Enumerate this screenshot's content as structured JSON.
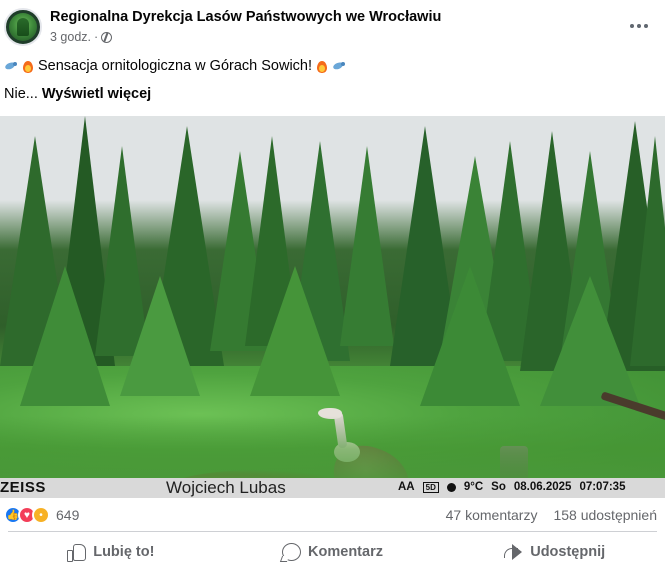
{
  "post": {
    "page_name": "Regionalna Dyrekcja Lasów Państwowych we Wrocławiu",
    "time": "3 godz.",
    "separator": "·",
    "text_main": "Sensacja ornitologiczna w Górach Sowich!",
    "text_truncated": "Nie...",
    "see_more": "Wyświetl więcej"
  },
  "photo": {
    "camera_brand": "ZEISS",
    "photographer": "Wojciech Lubas",
    "battery": "AA",
    "mode_box": "5D",
    "temperature": "9°C",
    "day": "So",
    "date": "08.06.2025",
    "time": "07:07:35"
  },
  "engagement": {
    "reaction_count": "649",
    "comments": "47 komentarzy",
    "shares": "158 udostępnień"
  },
  "actions": {
    "like": "Lubię to!",
    "comment": "Komentarz",
    "share": "Udostępnij"
  },
  "colors": {
    "like_blue": "#1877f2",
    "love_red": "#f33e58",
    "wow_yellow": "#f7b125",
    "secondary_text": "#65676b"
  },
  "icons": [
    "globe-icon",
    "more-options-icon",
    "bird-emoji",
    "fire-emoji",
    "like-reaction-icon",
    "love-reaction-icon",
    "wow-reaction-icon",
    "thumbs-up-icon",
    "comment-icon",
    "share-icon"
  ]
}
